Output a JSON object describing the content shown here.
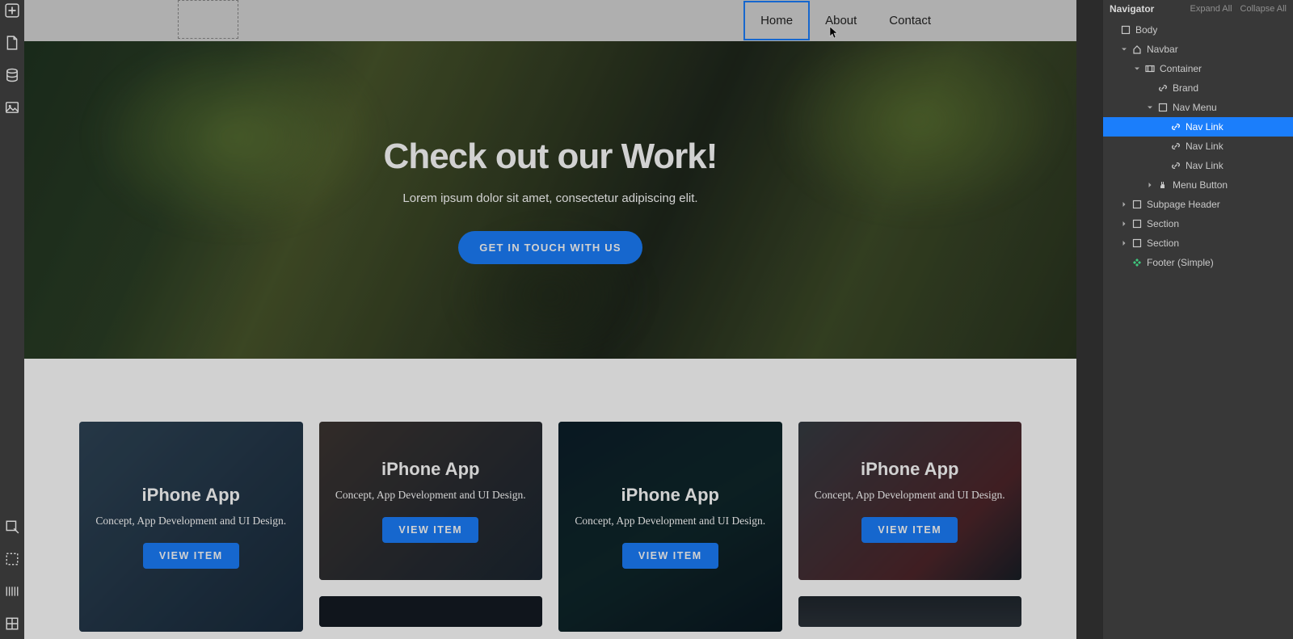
{
  "left_tools": {
    "add": "add-icon",
    "page": "page-icon",
    "data": "database-icon",
    "assets": "image-icon",
    "bottom": [
      "select-icon",
      "bbox-icon",
      "align-icon",
      "grid-icon"
    ]
  },
  "site": {
    "nav": [
      "Home",
      "About",
      "Contact"
    ],
    "selected_nav_index": 0,
    "selection_badge": "Nav Link",
    "hero": {
      "title": "Check out our Work!",
      "subtitle": "Lorem ipsum dolor sit amet, consectetur adipiscing elit.",
      "cta": "GET IN TOUCH WITH US"
    },
    "cards": [
      {
        "title": "iPhone App",
        "desc": "Concept, App Development and UI Design.",
        "btn": "VIEW ITEM"
      },
      {
        "title": "iPhone App",
        "desc": "Concept, App Development and UI Design.",
        "btn": "VIEW ITEM"
      },
      {
        "title": "iPhone App",
        "desc": "Concept, App Development and UI Design.",
        "btn": "VIEW ITEM"
      },
      {
        "title": "iPhone App",
        "desc": "Concept, App Development and UI Design.",
        "btn": "VIEW ITEM"
      }
    ]
  },
  "navigator": {
    "title": "Navigator",
    "expand": "Expand All",
    "collapse": "Collapse All",
    "tree": [
      {
        "indent": 0,
        "caret": "none",
        "icon": "box",
        "label": "Body"
      },
      {
        "indent": 1,
        "caret": "down",
        "icon": "home",
        "label": "Navbar"
      },
      {
        "indent": 2,
        "caret": "down",
        "icon": "container",
        "label": "Container"
      },
      {
        "indent": 3,
        "caret": "none",
        "icon": "link",
        "label": "Brand"
      },
      {
        "indent": 3,
        "caret": "down",
        "icon": "box",
        "label": "Nav Menu"
      },
      {
        "indent": 4,
        "caret": "none",
        "icon": "link",
        "label": "Nav Link",
        "selected": true
      },
      {
        "indent": 4,
        "caret": "none",
        "icon": "link",
        "label": "Nav Link"
      },
      {
        "indent": 4,
        "caret": "none",
        "icon": "link",
        "label": "Nav Link"
      },
      {
        "indent": 3,
        "caret": "right",
        "icon": "hand",
        "label": "Menu Button"
      },
      {
        "indent": 1,
        "caret": "right",
        "icon": "box",
        "label": "Subpage Header"
      },
      {
        "indent": 1,
        "caret": "right",
        "icon": "box",
        "label": "Section"
      },
      {
        "indent": 1,
        "caret": "right",
        "icon": "box",
        "label": "Section"
      },
      {
        "indent": 1,
        "caret": "none",
        "icon": "component",
        "label": "Footer (Simple)"
      }
    ]
  }
}
